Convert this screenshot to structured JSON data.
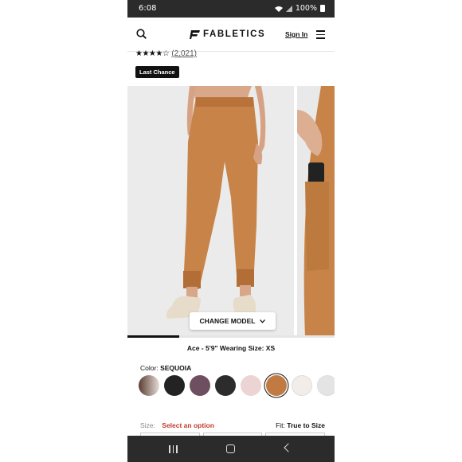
{
  "status_bar": {
    "time": "6:08",
    "battery": "100%",
    "icons": [
      "wifi-icon",
      "signal-icon",
      "battery-icon"
    ]
  },
  "header": {
    "logo_text": "FABLETICS",
    "sign_in_label": "Sign In",
    "icons": [
      "search-icon",
      "menu-icon"
    ]
  },
  "product": {
    "stars": "★★★★☆",
    "review_count": "(2,021)",
    "badge": "Last Chance",
    "change_model_label": "CHANGE MODEL",
    "model_info": "Ace - 5'9\" Wearing Size: XS",
    "gallery_progress": 0.25,
    "color": {
      "label": "Color:",
      "selected": "SEQUOIA",
      "swatches": [
        "#d8cfc9",
        "#232323",
        "#6e4f62",
        "#2c2c2c",
        "#ecd4d4",
        "#c27a43",
        "#f2ede8",
        "#e4e4e4"
      ],
      "selected_index": 5
    },
    "size": {
      "label": "Size:",
      "option_text": "Select an option",
      "fit_label": "Fit:",
      "fit_value": "True to Size"
    }
  },
  "colors": {
    "accent": "#111111",
    "error": "#c0392b",
    "system_bar": "#2b2b2b",
    "product": "#c27a43"
  }
}
